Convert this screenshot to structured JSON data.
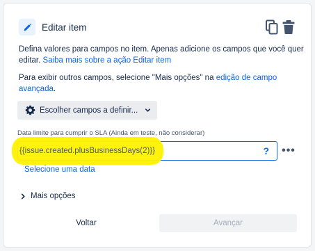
{
  "header": {
    "title": "Editar item",
    "edit_icon": "pencil-icon",
    "copy_icon": "copy-icon",
    "delete_icon": "trash-icon"
  },
  "description": {
    "text": "Defina valores para campos no item. Apenas adicione os campos que você quer editar.",
    "link": "Saiba mais sobre a ação Editar item"
  },
  "advanced": {
    "text": "Para exibir outros campos, selecione \"Mais opções\" na",
    "link": "edição de campo avançada",
    "suffix": "."
  },
  "choose_fields": {
    "label": "Escolher campos a definir...",
    "icon": "gear-icon",
    "chevron": "chevron-down-icon"
  },
  "field": {
    "label": "Data limite para cumprir o SLA (Ainda em teste, não considerar)",
    "value": "{{issue.created.plusBusinessDays(2)}}",
    "help": "?",
    "more": "•••",
    "select_date": "Selecione uma data"
  },
  "more_options": {
    "label": "Mais opções",
    "icon": "chevron-right-icon"
  },
  "footer": {
    "back_label": "Voltar",
    "next_label": "Avançar"
  },
  "colors": {
    "accent": "#0c66e4",
    "highlight": "#fff200"
  }
}
